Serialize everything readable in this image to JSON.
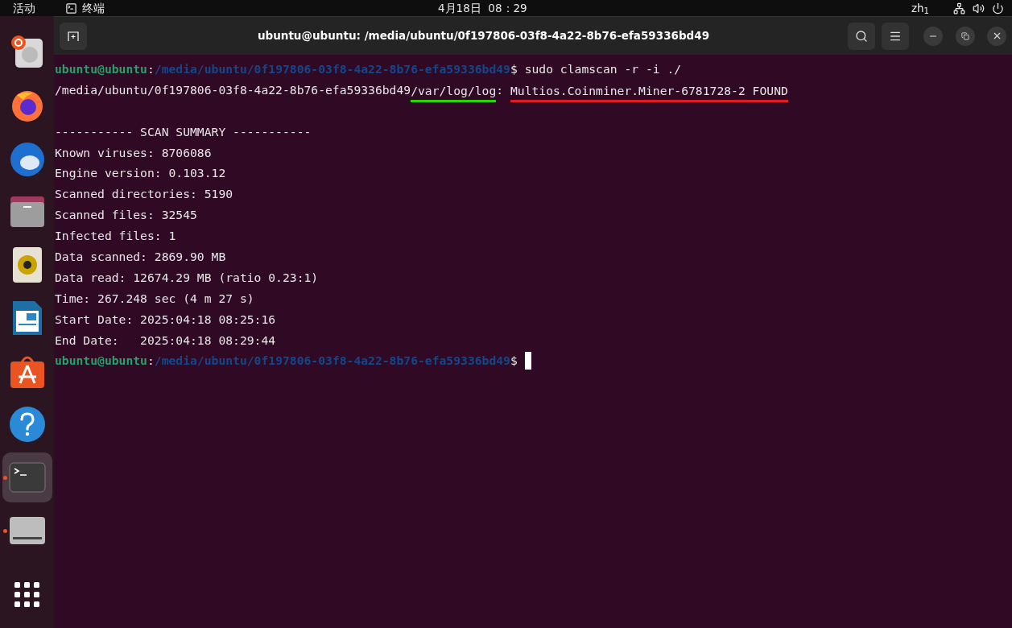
{
  "top_bar": {
    "activities": "活动",
    "app_name": "终端",
    "clock": "4月18日  08：29",
    "input_method": "zh$_{1}$"
  },
  "dock": [
    {
      "kind": "disk",
      "running": false,
      "selected": false
    },
    {
      "kind": "browser",
      "running": false,
      "selected": false
    },
    {
      "kind": "mail",
      "running": false,
      "selected": false
    },
    {
      "kind": "files",
      "running": false,
      "selected": false
    },
    {
      "kind": "music",
      "running": false,
      "selected": false
    },
    {
      "kind": "writer",
      "running": false,
      "selected": false
    },
    {
      "kind": "store",
      "running": false,
      "selected": false
    },
    {
      "kind": "help",
      "running": false,
      "selected": false
    },
    {
      "kind": "terminal",
      "running": true,
      "selected": true
    },
    {
      "kind": "drive",
      "running": true,
      "selected": false
    },
    {
      "kind": "apps",
      "running": false,
      "selected": false
    }
  ],
  "window": {
    "title": "ubuntu@ubuntu: /media/ubuntu/0f197806-03f8-4a22-8b76-efa59336bd49"
  },
  "terminal": [
    {
      "kind": "prompt",
      "user": "ubuntu@ubuntu",
      "colon": ":",
      "path": "/media/ubuntu/0f197806-03f8-4a22-8b76-efa59336bd49",
      "dollar": "$",
      "command": "sudo clamscan -r -i ./"
    },
    {
      "kind": "result",
      "path": "/media/ubuntu/0f197806-03f8-4a22-8b76-efa59336bd49",
      "file": "/var/log/log",
      "separator": ": ",
      "detection": "Multios.Coinminer.Miner-6781728-2 FOUND"
    },
    {
      "kind": "blank"
    },
    {
      "kind": "text",
      "text": "----------- SCAN SUMMARY -----------"
    },
    {
      "kind": "text",
      "text": "Known viruses: 8706086"
    },
    {
      "kind": "text",
      "text": "Engine version: 0.103.12"
    },
    {
      "kind": "text",
      "text": "Scanned directories: 5190"
    },
    {
      "kind": "text",
      "text": "Scanned files: 32545"
    },
    {
      "kind": "text",
      "text": "Infected files: 1"
    },
    {
      "kind": "text",
      "text": "Data scanned: 2869.90 MB"
    },
    {
      "kind": "text",
      "text": "Data read: 12674.29 MB (ratio 0.23:1)"
    },
    {
      "kind": "text",
      "text": "Time: 267.248 sec (4 m 27 s)"
    },
    {
      "kind": "text",
      "text": "Start Date: 2025:04:18 08:25:16"
    },
    {
      "kind": "text",
      "text": "End Date:   2025:04:18 08:29:44"
    },
    {
      "kind": "prompt",
      "user": "ubuntu@ubuntu",
      "colon": ":",
      "path": "/media/ubuntu/0f197806-03f8-4a22-8b76-efa59336bd49",
      "dollar": "$",
      "cursor": true
    }
  ]
}
